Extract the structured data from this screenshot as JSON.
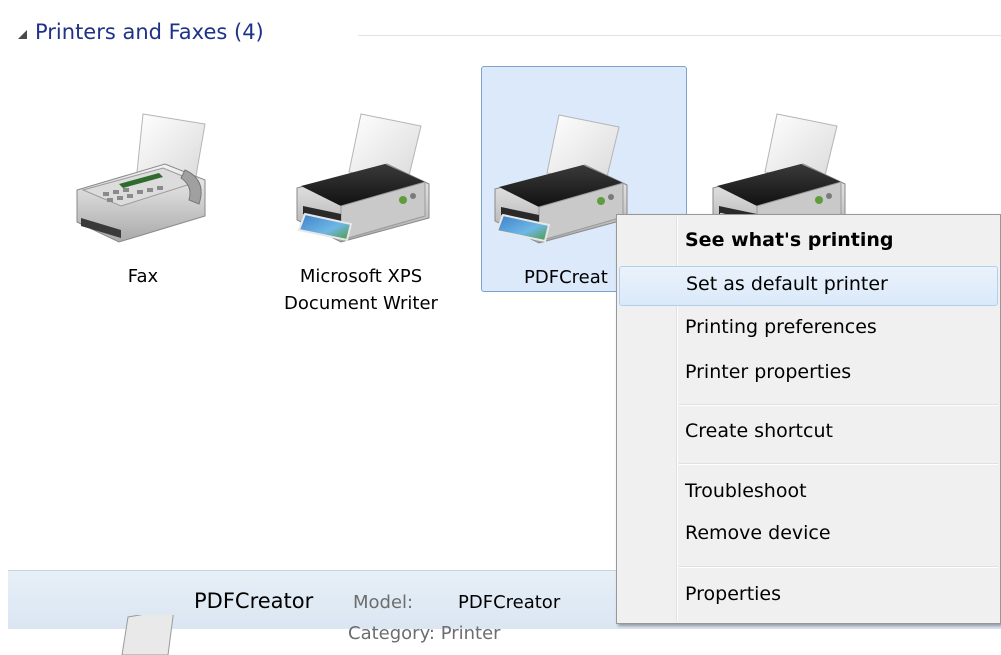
{
  "group": {
    "title": "Printers and Faxes (4)"
  },
  "devices": [
    {
      "label_line1": "Fax",
      "label_line2": "",
      "icon": "fax-icon"
    },
    {
      "label_line1": "Microsoft XPS",
      "label_line2": "Document Writer",
      "icon": "printer-icon"
    },
    {
      "label_line1": "PDFCreat",
      "label_line2": "",
      "icon": "printer-icon",
      "selected": true
    },
    {
      "label_line1": "",
      "label_line2": "",
      "icon": "printer-icon"
    }
  ],
  "context_menu": {
    "items": [
      {
        "label": "See what's printing",
        "bold": true
      },
      {
        "label": "Set as default printer",
        "hover": true
      },
      {
        "label": "Printing preferences"
      },
      {
        "label": "Printer properties"
      },
      {
        "label": "Create shortcut"
      },
      {
        "label": "Troubleshoot"
      },
      {
        "label": "Remove device"
      },
      {
        "label": "Properties"
      }
    ]
  },
  "details": {
    "name": "PDFCreator",
    "model_label": "Model:",
    "model_value": "PDFCreator",
    "partial_text": "Category: Printer"
  },
  "colors": {
    "group_title": "#1e3287",
    "selection_bg": "#dbe9fa",
    "selection_border": "#7da2ce",
    "menu_bg": "#f0f0f0",
    "menu_hover": "#dae9fa"
  }
}
